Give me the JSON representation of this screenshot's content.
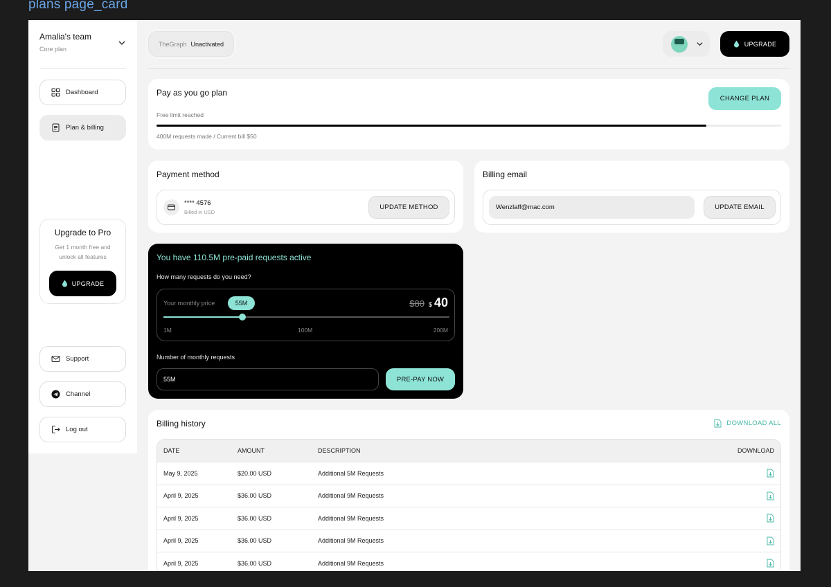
{
  "canvas_label": "plans page_card",
  "sidebar": {
    "team_name": "Amalia's team",
    "team_plan": "Core plan",
    "nav": [
      {
        "label": "Dashboard",
        "icon": "grid-icon"
      },
      {
        "label": "Plan & billing",
        "icon": "document-icon"
      }
    ],
    "promo": {
      "title": "Upgrade to Pro",
      "text": "Get 1 month free and unlock all features",
      "button": "UPGRADE"
    },
    "bottom": [
      {
        "label": "Support",
        "icon": "mail-icon"
      },
      {
        "label": "Channel",
        "icon": "telegram-icon"
      },
      {
        "label": "Log out",
        "icon": "logout-icon"
      }
    ]
  },
  "header": {
    "breadcrumb_app": "TheGraph",
    "breadcrumb_status": "Unactivated",
    "upgrade_label": "UPGRADE"
  },
  "plan": {
    "title": "Pay as you go plan",
    "change_label": "CHANGE PLAN",
    "limit_text": "Free limit reached",
    "progress": 0.88,
    "usage_text": "400M requests made / Current bill $50"
  },
  "payment": {
    "title": "Payment method",
    "card_number": "**** 4576",
    "card_sub": "Billed in USD",
    "update_label": "UPDATE METHOD"
  },
  "billing_email": {
    "title": "Billing email",
    "email": "Wenzlaff@mac.com",
    "update_label": "UPDATE EMAIL"
  },
  "prepaid": {
    "title": "You have 110.5M pre-paid requests active",
    "question": "How many requests do you need?",
    "price_label": "Your monthly price",
    "selected": "55M",
    "old_price": "$80",
    "currency": "$",
    "new_price": "40",
    "slider_value": 0.275,
    "ticks": [
      "1M",
      "100M",
      "200M"
    ],
    "number_label": "Number of monthly requests",
    "input_value": "55M",
    "button": "PRE-PAY NOW"
  },
  "billing_history": {
    "title": "Billing history",
    "download_all": "DOWNLOAD ALL",
    "columns": [
      "DATE",
      "AMOUNT",
      "DESCRIPTION",
      "DOWNLOAD"
    ],
    "rows": [
      {
        "date": "May 9, 2025",
        "amount": "$20.00 USD",
        "description": "Additional 5M Requests"
      },
      {
        "date": "April 9, 2025",
        "amount": "$36.00 USD",
        "description": "Additional 9M Requests"
      },
      {
        "date": "April 9, 2025",
        "amount": "$36.00 USD",
        "description": "Additional 9M Requests"
      },
      {
        "date": "April 9, 2025",
        "amount": "$36.00 USD",
        "description": "Additional 9M Requests"
      },
      {
        "date": "April 9, 2025",
        "amount": "$36.00 USD",
        "description": "Additional 9M Requests"
      }
    ]
  },
  "colors": {
    "accent": "#8de3d6",
    "link": "#44b5a4",
    "dark": "#000000"
  }
}
